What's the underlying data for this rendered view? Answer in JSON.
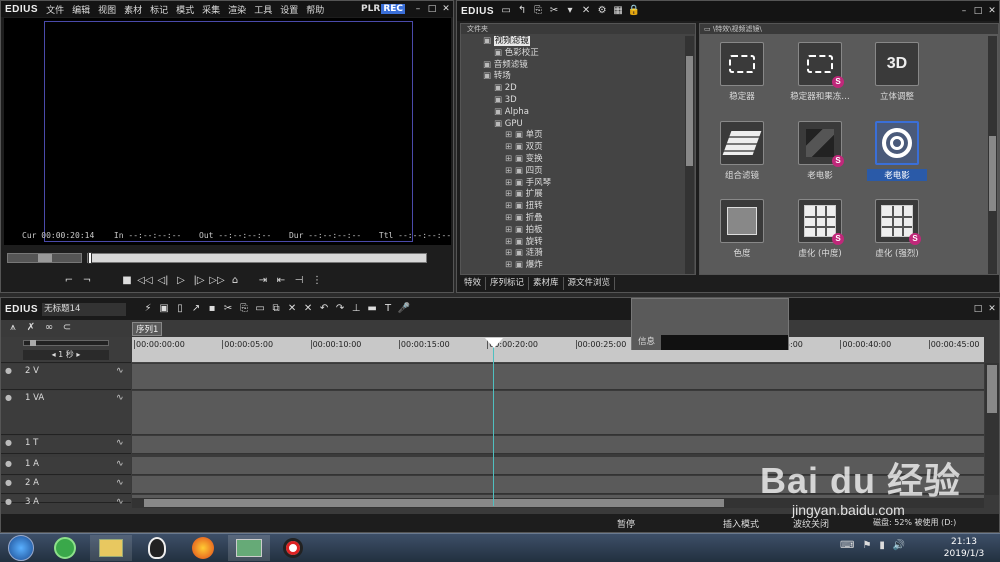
{
  "player": {
    "brand": "EDIUS",
    "menu": [
      "文件",
      "编辑",
      "视图",
      "素材",
      "标记",
      "模式",
      "采集",
      "渲染",
      "工具",
      "设置",
      "帮助"
    ],
    "plr": "PLR",
    "rec": "REC",
    "cur_label": "Cur",
    "cur_value": "00:00:20:14",
    "in_label": "In",
    "in_value": "--:--:--:--",
    "out_label": "Out",
    "out_value": "--:--:--:--",
    "dur_label": "Dur",
    "dur_value": "--:--:--:--",
    "ttl_label": "Ttl",
    "ttl_value": "--:--:--:--"
  },
  "effects": {
    "brand": "EDIUS",
    "folder_header": "文件夹",
    "breadcrumb": "\\特效\\视频滤镜\\",
    "tree": [
      {
        "label": "视频滤镜",
        "indent": 2,
        "selected": true
      },
      {
        "label": "色彩校正",
        "indent": 3
      },
      {
        "label": "音频滤镜",
        "indent": 2
      },
      {
        "label": "转场",
        "indent": 2
      },
      {
        "label": "2D",
        "indent": 3
      },
      {
        "label": "3D",
        "indent": 3
      },
      {
        "label": "Alpha",
        "indent": 3
      },
      {
        "label": "GPU",
        "indent": 3
      },
      {
        "label": "单页",
        "indent": 4
      },
      {
        "label": "双页",
        "indent": 4
      },
      {
        "label": "变换",
        "indent": 4
      },
      {
        "label": "四页",
        "indent": 4
      },
      {
        "label": "手风琴",
        "indent": 4
      },
      {
        "label": "扩展",
        "indent": 4
      },
      {
        "label": "扭转",
        "indent": 4
      },
      {
        "label": "折叠",
        "indent": 4
      },
      {
        "label": "拍板",
        "indent": 4
      },
      {
        "label": "旋转",
        "indent": 4
      },
      {
        "label": "涟漪",
        "indent": 4
      },
      {
        "label": "爆炸",
        "indent": 4
      }
    ],
    "tiles": [
      {
        "label": "稳定器",
        "icon": "stabilizer-icon",
        "badge": false
      },
      {
        "label": "稳定器和果冻…",
        "icon": "stabilizer-rolling-icon",
        "badge": true
      },
      {
        "label": "立体调整",
        "icon": "3d-icon",
        "glyph": "3D",
        "badge": false
      },
      {
        "label": "组合滤镜",
        "icon": "layers-icon",
        "badge": false
      },
      {
        "label": "老电影",
        "icon": "old-movie-icon",
        "badge": true
      },
      {
        "label": "老电影",
        "icon": "film-reel-icon",
        "badge": false,
        "selected": true
      },
      {
        "label": "色度",
        "icon": "chroma-icon",
        "badge": false
      },
      {
        "label": "虚化 (中度)",
        "icon": "blur-grid-icon",
        "badge": true
      },
      {
        "label": "虚化 (强烈)",
        "icon": "blur-grid-icon",
        "badge": true
      }
    ],
    "tabs": [
      "特效",
      "序列标记",
      "素材库",
      "源文件浏览"
    ],
    "info_label": "信息"
  },
  "timeline": {
    "brand": "EDIUS",
    "project": "无标题14",
    "sequence_tab": "序列1",
    "scale": "1 秒",
    "ruler": [
      "00:00:00:00",
      "00:00:05:00",
      "00:00:10:00",
      "00:00:15:00",
      "00:00:20:00",
      "00:00:25:00",
      "00:00:30:00",
      "00:00:35:00",
      "00:00:40:00",
      "00:00:45:00"
    ],
    "tracks": [
      {
        "label": "2 V"
      },
      {
        "label": "1 VA"
      },
      {
        "label": "1 T"
      },
      {
        "label": "1 A"
      },
      {
        "label": "2 A"
      },
      {
        "label": "3 A"
      }
    ],
    "status": [
      "暂停",
      "插入模式",
      "波纹关闭",
      "磁盘: 52% 被使用 (D:)"
    ]
  },
  "taskbar": {
    "time": "21:13",
    "date": "2019/1/3"
  },
  "watermark": {
    "text": "Bai du 经验",
    "url": "jingyan.baidu.com"
  },
  "colors": {
    "accent_blue": "#2a5aa8",
    "rec_blue": "#3a6fd8",
    "playhead": "#4fc0c0",
    "badge_pink": "#c0287a"
  }
}
